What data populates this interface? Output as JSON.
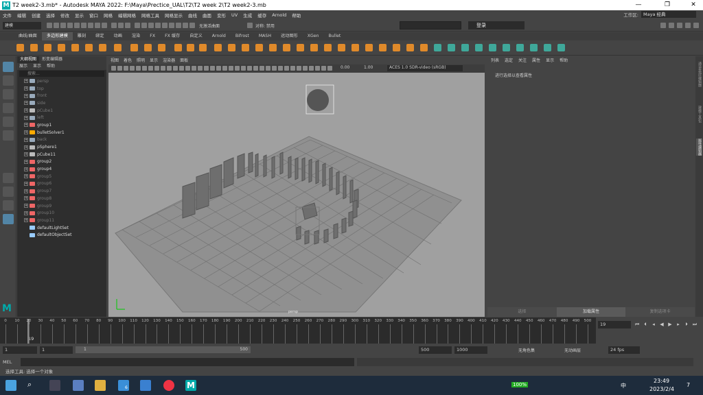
{
  "window": {
    "title": "T2 week2-3.mb* - Autodesk MAYA 2022: F:\\Maya\\Prectice_UAL\\T2\\T2 week 2\\T2 week2-3.mb",
    "controls": [
      "—",
      "❐",
      "✕"
    ]
  },
  "menubar": [
    "文件",
    "编辑",
    "创建",
    "选择",
    "修改",
    "显示",
    "窗口",
    "网格",
    "编辑网格",
    "网格工具",
    "网格显示",
    "曲线",
    "曲面",
    "变形",
    "UV",
    "生成",
    "缓存",
    "Arnold",
    "帮助"
  ],
  "workspace": {
    "label": "工作区:",
    "value": "Maya 经典"
  },
  "statusline": {
    "mode": "建模",
    "symmetry_label": "无激活曲面",
    "symmetry": "对称: 禁用",
    "login": "登录"
  },
  "shelf_tabs": [
    "曲线/曲面",
    "多边形建模",
    "雕刻",
    "绑定",
    "动画",
    "渲染",
    "FX",
    "FX 缓存",
    "自定义",
    "Arnold",
    "Bifrost",
    "MASH",
    "运动图形",
    "XGen",
    "Bullet"
  ],
  "shelf_active": 1,
  "outliner": {
    "tabs": [
      "大纲视图",
      "形变编辑器"
    ],
    "menu": [
      "展示",
      "显示",
      "帮助"
    ],
    "search_placeholder": "搜索...",
    "items": [
      {
        "label": "persp",
        "dim": true,
        "type": "cam",
        "expand": true
      },
      {
        "label": "top",
        "dim": true,
        "type": "cam",
        "expand": true
      },
      {
        "label": "front",
        "dim": true,
        "type": "cam",
        "expand": true
      },
      {
        "label": "side",
        "dim": true,
        "type": "cam",
        "expand": true
      },
      {
        "label": "pCube1",
        "dim": true,
        "type": "mesh",
        "expand": true
      },
      {
        "label": "left",
        "dim": true,
        "type": "cam",
        "expand": true
      },
      {
        "label": "group1",
        "dim": false,
        "type": "group",
        "expand": true
      },
      {
        "label": "bulletSolver1",
        "dim": false,
        "type": "solver",
        "expand": true
      },
      {
        "label": "back",
        "dim": true,
        "type": "cam",
        "expand": true
      },
      {
        "label": "pSphere1",
        "dim": false,
        "type": "mesh",
        "expand": true
      },
      {
        "label": "pCube11",
        "dim": false,
        "type": "mesh",
        "expand": true
      },
      {
        "label": "group2",
        "dim": false,
        "type": "group",
        "expand": true
      },
      {
        "label": "group4",
        "dim": false,
        "type": "group",
        "expand": true
      },
      {
        "label": "group5",
        "dim": true,
        "type": "group",
        "expand": true
      },
      {
        "label": "group6",
        "dim": true,
        "type": "group",
        "expand": true
      },
      {
        "label": "group7",
        "dim": true,
        "type": "group",
        "expand": true
      },
      {
        "label": "group8",
        "dim": true,
        "type": "group",
        "expand": true
      },
      {
        "label": "group9",
        "dim": true,
        "type": "group",
        "expand": true
      },
      {
        "label": "group10",
        "dim": true,
        "type": "group",
        "expand": true
      },
      {
        "label": "group11",
        "dim": true,
        "type": "group",
        "expand": true
      },
      {
        "label": "defaultLightSet",
        "dim": false,
        "type": "set",
        "expand": false
      },
      {
        "label": "defaultObjectSet",
        "dim": false,
        "type": "set",
        "expand": false
      }
    ]
  },
  "viewport": {
    "menu": [
      "视图",
      "着色",
      "照明",
      "显示",
      "渲染器",
      "面板"
    ],
    "value_a": "0.00",
    "value_b": "1.00",
    "colorspace": "ACES 1.0 SDR-video (sRGB)",
    "camera_label": "persp"
  },
  "attribute_editor": {
    "menu": [
      "列表",
      "选定",
      "关注",
      "属性",
      "显示",
      "帮助"
    ],
    "hint": "进行选择以查看属性",
    "bottom_tabs": [
      "选择",
      "加载属性",
      "复制选项卡"
    ],
    "active_tab": 1
  },
  "side_tabs": [
    "通道盒/层编辑器",
    "建模工具包",
    "属性编辑器"
  ],
  "timeline": {
    "ticks": [
      0,
      10,
      20,
      30,
      40,
      50,
      60,
      70,
      80,
      90,
      100,
      110,
      120,
      130,
      140,
      150,
      160,
      170,
      180,
      190,
      200,
      210,
      220,
      230,
      240,
      250,
      260,
      270,
      280,
      290,
      300,
      310,
      320,
      330,
      340,
      350,
      360,
      370,
      380,
      390,
      400,
      410,
      420,
      430,
      440,
      450,
      460,
      470,
      480,
      490,
      500
    ],
    "current_label": "19",
    "current_frame": "19"
  },
  "range": {
    "start": "1",
    "start2": "1",
    "bar_start": "1",
    "bar_end": "500",
    "end": "500",
    "end2": "1000",
    "char_set": "无角色集",
    "anim_layer": "无动画层",
    "fps": "24 fps"
  },
  "cmdline": {
    "label": "MEL"
  },
  "helpline": "选择工具: 选择一个对象",
  "taskbar": {
    "battery": "100%",
    "ime": "中",
    "time": "23:49",
    "date": "2023/2/4",
    "notif": "7",
    "mail_badge": "6"
  },
  "colors": {
    "accent": "#5285a6",
    "viewport_bg": "#a0a0a0",
    "maya_teal": "#0aa"
  }
}
